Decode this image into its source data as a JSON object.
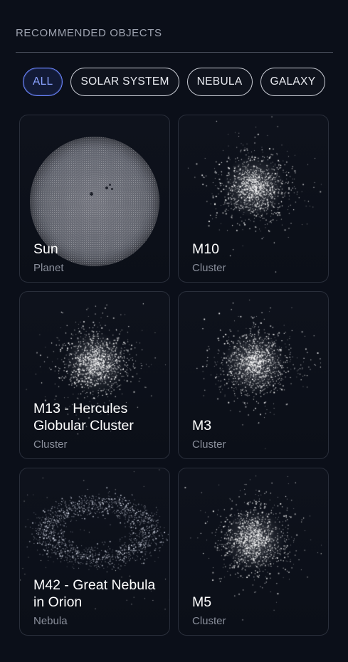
{
  "header": {
    "title": "RECOMMENDED OBJECTS"
  },
  "filters": [
    {
      "label": "ALL",
      "active": true
    },
    {
      "label": "SOLAR SYSTEM",
      "active": false
    },
    {
      "label": "NEBULA",
      "active": false
    },
    {
      "label": "GALAXY",
      "active": false
    }
  ],
  "objects": [
    {
      "name": "Sun",
      "type": "Planet",
      "art": "sun"
    },
    {
      "name": "M10",
      "type": "Cluster",
      "art": "cluster"
    },
    {
      "name": "M13 - Hercules Globular Cluster",
      "type": "Cluster",
      "art": "cluster"
    },
    {
      "name": "M3",
      "type": "Cluster",
      "art": "cluster"
    },
    {
      "name": "M42 - Great Nebula in Orion",
      "type": "Nebula",
      "art": "nebula"
    },
    {
      "name": "M5",
      "type": "Cluster",
      "art": "cluster"
    }
  ],
  "colors": {
    "background": "#0b0f19",
    "accent": "#6c86ff",
    "muted_text": "#8a8f9b"
  }
}
